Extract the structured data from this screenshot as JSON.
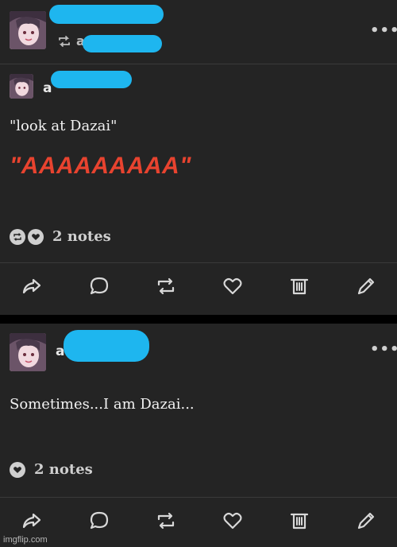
{
  "post1": {
    "username": "a",
    "reblog_source": "a",
    "quoted_username": "a",
    "quote_text": "\"look at Dazai\"",
    "shout_text": "\"AAAAAAAAA\"",
    "notes": "2 notes",
    "more": "•••"
  },
  "post2": {
    "username": "a",
    "body_text": "Sometimes...I am Dazai...",
    "notes": "2 notes",
    "more": "•••"
  },
  "actions": [
    "share-icon",
    "reply-icon",
    "reblog-icon",
    "like-icon",
    "delete-icon",
    "edit-icon"
  ],
  "colors": {
    "background": "#242424",
    "accent_redaction": "#1eb6ef",
    "shout": "#e8432f"
  },
  "watermark": "imgflip.com"
}
